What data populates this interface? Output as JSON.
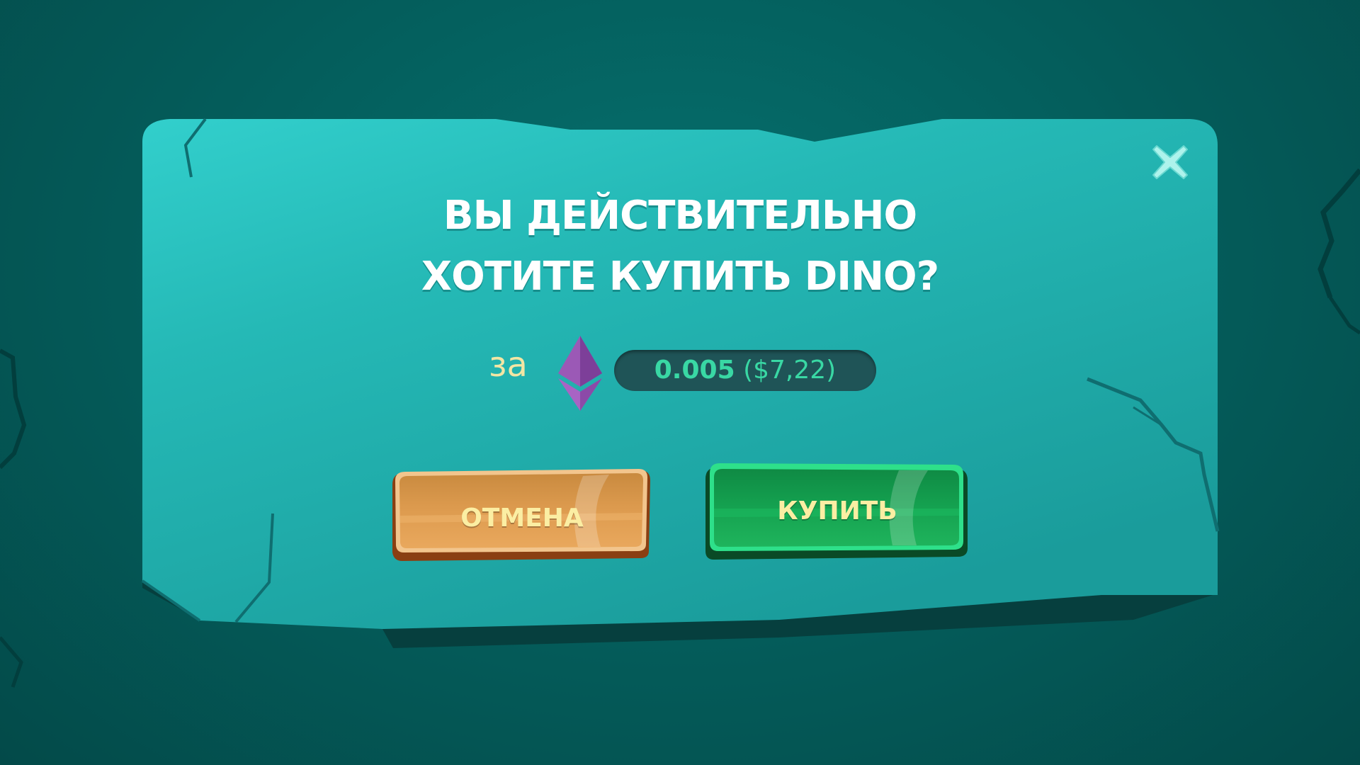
{
  "dialog": {
    "title_line1": "ВЫ ДЕЙСТВИТЕЛЬНО",
    "title_line2": "ХОТИТЕ КУПИТЬ DINO?"
  },
  "price": {
    "prefix": "за",
    "currency_icon": "ethereum-icon",
    "eth_amount": "0.005",
    "usd_amount": "($7,22)"
  },
  "buttons": {
    "cancel_label": "ОТМЕНА",
    "buy_label": "КУПИТЬ",
    "close_icon": "close-icon"
  },
  "colors": {
    "background": "#045f5d",
    "panel": "#21b3b0",
    "title": "#ffffff",
    "prefix": "#f2e6a4",
    "price_text": "#39d8a4",
    "cancel_button": "#e39a4e",
    "buy_button": "#17a251",
    "button_text": "#fbeea3",
    "close_icon": "#aef3ec",
    "eth_icon": "#9b59b6"
  }
}
